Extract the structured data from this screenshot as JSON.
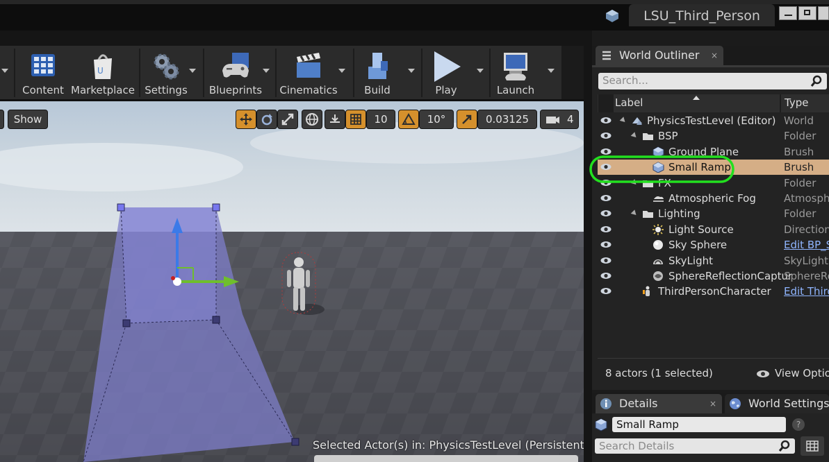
{
  "window": {
    "project_name": "LSU_Third_Person"
  },
  "toolbar": {
    "items": [
      {
        "label": "Content",
        "icon": "content-browser-icon"
      },
      {
        "label": "Marketplace",
        "icon": "marketplace-bag-icon"
      },
      {
        "label": "Settings",
        "icon": "settings-gears-icon"
      },
      {
        "label": "Blueprints",
        "icon": "blueprints-gamepad-icon"
      },
      {
        "label": "Cinematics",
        "icon": "clapperboard-icon"
      },
      {
        "label": "Build",
        "icon": "build-blocks-icon"
      },
      {
        "label": "Play",
        "icon": "play-triangle-icon"
      },
      {
        "label": "Launch",
        "icon": "launch-monitor-icon"
      }
    ]
  },
  "viewport": {
    "show_label": "Show",
    "grid_snap": "10",
    "rotation_snap": "10°",
    "scale_snap": "0.03125",
    "camera_speed": "4",
    "selected_actor_text": "Selected Actor(s) in:  PhysicsTestLevel (Persistent)"
  },
  "outliner": {
    "tab_label": "World Outliner",
    "search_placeholder": "Search...",
    "col_label": "Label",
    "col_type": "Type",
    "rows": [
      {
        "name": "PhysicsTestLevel (Editor)",
        "type": "World",
        "indent": 0,
        "icon": "world-icon",
        "arrow": true
      },
      {
        "name": "BSP",
        "type": "Folder",
        "indent": 1,
        "icon": "folder-icon",
        "arrow": true
      },
      {
        "name": "Ground Plane",
        "type": "Brush",
        "indent": 2,
        "icon": "brush-cube-icon"
      },
      {
        "name": "Small Ramp",
        "type": "Brush",
        "indent": 2,
        "icon": "brush-cube-icon",
        "selected": true
      },
      {
        "name": "FX",
        "type": "Folder",
        "indent": 1,
        "icon": "folder-icon",
        "arrow": true
      },
      {
        "name": "Atmospheric Fog",
        "type": "Atmospheric",
        "indent": 2,
        "icon": "fog-icon"
      },
      {
        "name": "Lighting",
        "type": "Folder",
        "indent": 1,
        "icon": "folder-icon",
        "arrow": true
      },
      {
        "name": "Light Source",
        "type": "Directional",
        "indent": 2,
        "icon": "sun-icon"
      },
      {
        "name": "Sky Sphere",
        "type": "Edit BP_S",
        "indent": 2,
        "icon": "sphere-icon",
        "link": true
      },
      {
        "name": "SkyLight",
        "type": "SkyLight",
        "indent": 2,
        "icon": "skylight-icon"
      },
      {
        "name": "SphereReflectionCaptur",
        "type": "SphereRef",
        "indent": 2,
        "icon": "reflection-icon"
      },
      {
        "name": "ThirdPersonCharacter",
        "type": "Edit Third",
        "indent": 1,
        "icon": "character-icon",
        "link": true
      }
    ],
    "actor_count": "8 actors (1 selected)",
    "view_options": "View Option"
  },
  "details": {
    "tab_label": "Details",
    "world_settings_label": "World Settings",
    "name_value": "Small Ramp",
    "search_placeholder": "Search Details"
  },
  "colors": {
    "selection": "#d5ae86",
    "highlight_ring": "#22e01f",
    "snap_orange": "#d5902c"
  }
}
